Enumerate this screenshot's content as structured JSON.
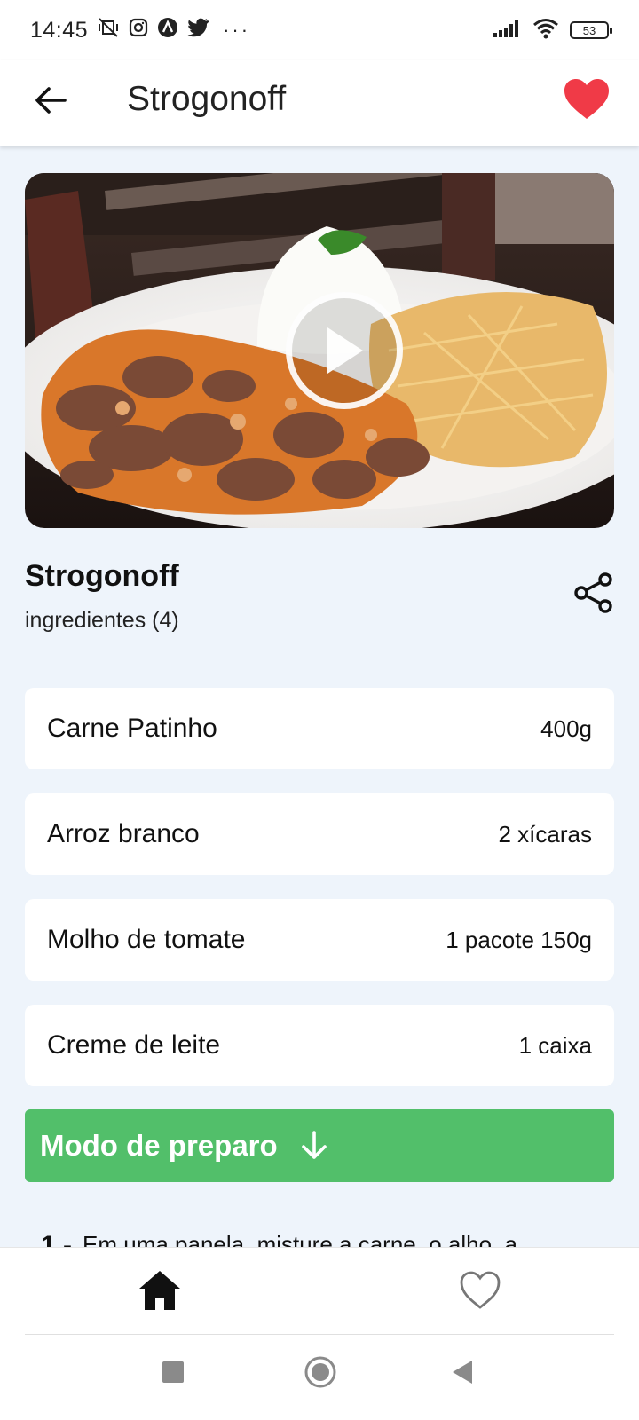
{
  "status_bar": {
    "time": "14:45",
    "battery_level": "53",
    "icons": [
      "vibrate-off-icon",
      "instagram-icon",
      "app-icon",
      "twitter-icon",
      "more-notifications-icon",
      "signal-icon",
      "wifi-icon",
      "battery-icon"
    ]
  },
  "app_bar": {
    "title": "Strogonoff",
    "favorite_color": "#f03a47"
  },
  "recipe": {
    "title": "Strogonoff",
    "ingredients_label": "ingredientes (4)",
    "ingredients": [
      {
        "name": "Carne Patinho",
        "qty": "400g"
      },
      {
        "name": "Arroz branco",
        "qty": "2 xícaras"
      },
      {
        "name": "Molho de tomate",
        "qty": "1 pacote 150g"
      },
      {
        "name": "Creme de leite",
        "qty": "1 caixa"
      }
    ],
    "prep_button_label": "Modo de preparo",
    "prep_button_color": "#52bf6a",
    "steps": [
      {
        "num": "1 -",
        "text": "Em uma panela, misture a carne, o alho, a"
      }
    ]
  },
  "bottom_nav": {
    "items": [
      "home-icon",
      "heart-outline-icon"
    ]
  },
  "system_nav": {
    "items": [
      "recents-button",
      "home-button",
      "back-button"
    ]
  }
}
